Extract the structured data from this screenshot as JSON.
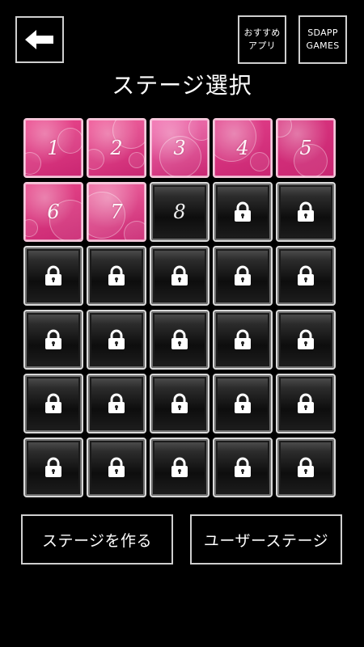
{
  "header": {
    "back_icon": "arrow-left-icon",
    "recommend_label_line1": "おすすめ",
    "recommend_label_line2": "アプリ",
    "sdapp_label_line1": "SDAPP",
    "sdapp_label_line2": "GAMES"
  },
  "title": "ステージ選択",
  "stages": [
    {
      "label": "1",
      "state": "cleared",
      "color": "#ec4a8e"
    },
    {
      "label": "2",
      "state": "cleared",
      "color": "#f05596"
    },
    {
      "label": "3",
      "state": "cleared",
      "color": "#f26fb0"
    },
    {
      "label": "4",
      "state": "cleared",
      "color": "#e23f8a"
    },
    {
      "label": "5",
      "state": "cleared",
      "color": "#d9357f"
    },
    {
      "label": "6",
      "state": "cleared",
      "color": "#e8498b"
    },
    {
      "label": "7",
      "state": "cleared",
      "color": "#f06aa2"
    },
    {
      "label": "8",
      "state": "current",
      "color": "#1a1a1a"
    },
    {
      "label": "",
      "state": "locked"
    },
    {
      "label": "",
      "state": "locked"
    },
    {
      "label": "",
      "state": "locked"
    },
    {
      "label": "",
      "state": "locked"
    },
    {
      "label": "",
      "state": "locked"
    },
    {
      "label": "",
      "state": "locked"
    },
    {
      "label": "",
      "state": "locked"
    },
    {
      "label": "",
      "state": "locked"
    },
    {
      "label": "",
      "state": "locked"
    },
    {
      "label": "",
      "state": "locked"
    },
    {
      "label": "",
      "state": "locked"
    },
    {
      "label": "",
      "state": "locked"
    },
    {
      "label": "",
      "state": "locked"
    },
    {
      "label": "",
      "state": "locked"
    },
    {
      "label": "",
      "state": "locked"
    },
    {
      "label": "",
      "state": "locked"
    },
    {
      "label": "",
      "state": "locked"
    },
    {
      "label": "",
      "state": "locked"
    },
    {
      "label": "",
      "state": "locked"
    },
    {
      "label": "",
      "state": "locked"
    },
    {
      "label": "",
      "state": "locked"
    },
    {
      "label": "",
      "state": "locked"
    }
  ],
  "lock_icon": "lock-icon",
  "footer": {
    "create_stage_label": "ステージを作る",
    "user_stage_label": "ユーザーステージ"
  },
  "colors": {
    "background": "#000000",
    "border": "#cfcfcf",
    "accent_pink": "#ec4a8e"
  }
}
